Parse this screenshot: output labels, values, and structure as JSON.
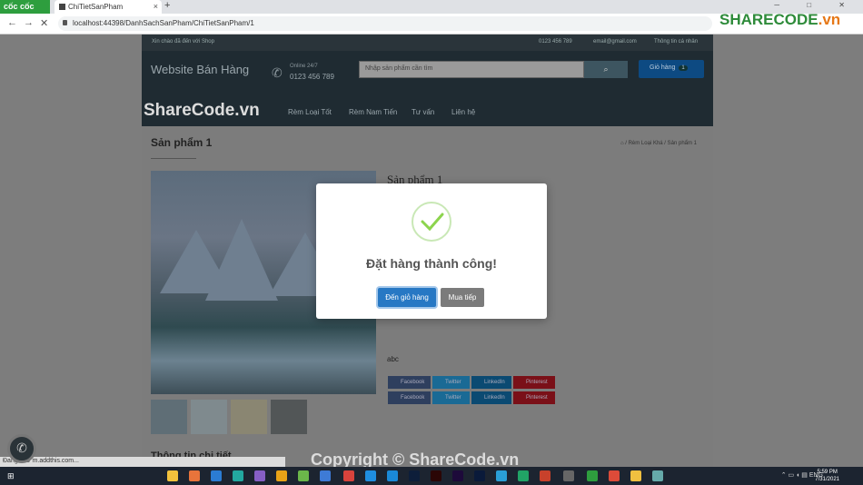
{
  "browser": {
    "brand": "cốc cốc",
    "tab_title": "ChiTietSanPham",
    "url": "localhost:44398/DanhSachSanPham/ChiTietSanPham/1",
    "watermark_logo": "SHARECODE",
    "watermark_logo_suffix": ".vn"
  },
  "site": {
    "welcome": "Xin chào đã đến với Shop",
    "top_phone": "0123 456 789",
    "top_email": "email@gmail.com",
    "top_account": "Thông tin cá nhân",
    "brand": "Website Bán Hàng",
    "hotline_label": "Online 24/7",
    "hotline_number": "0123 456 789",
    "search_placeholder": "Nhập sản phẩm cần tìm",
    "cart_label": "Giỏ hàng",
    "cart_count": "1",
    "watermark": "ShareCode.vn",
    "menu": [
      "Rèm Loại Tốt",
      "Rèm Nam Tiến",
      "Tư vấn",
      "Liên hệ"
    ],
    "page_title": "Sản phẩm 1",
    "breadcrumb": [
      "Rèm Loại Khá",
      "Sản phẩm 1"
    ],
    "product_title": "Sản phẩm 1",
    "product_desc": "abc",
    "share_buttons": [
      "Facebook",
      "Twitter",
      "LinkedIn",
      "Pinterest"
    ],
    "section_title": "Thông tin chi tiết",
    "copyright": "Copyright © ShareCode.vn",
    "status": "Đang chờ m.addthis.com..."
  },
  "modal": {
    "title": "Đặt hàng thành công!",
    "cart_button": "Đến giỏ hàng",
    "continue_button": "Mua tiếp"
  },
  "taskbar": {
    "time": "5:59 PM",
    "date": "7/31/2021",
    "lang": "ENG"
  },
  "colors": {
    "primary": "#2778c4",
    "success": "#8cd44d",
    "facebook": "#3b5998",
    "twitter": "#1da1f2",
    "linkedin": "#0077b5",
    "pinterest": "#bd081c"
  }
}
